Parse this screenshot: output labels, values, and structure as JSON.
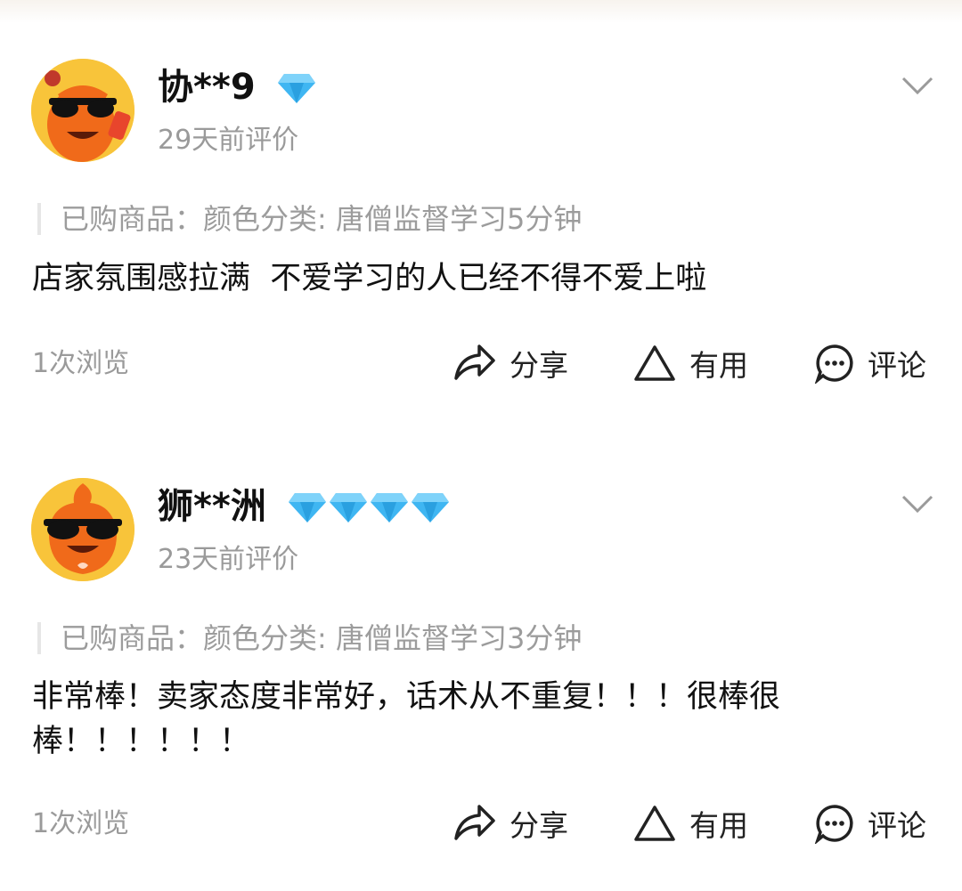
{
  "reviews": [
    {
      "username": "协**9",
      "diamond_level": 1,
      "time": "29天前评价",
      "product": "已购商品：颜色分类: 唐僧监督学习5分钟",
      "content": "店家氛围感拉满  不爱学习的人已经不得不爱上啦",
      "views": "1次浏览",
      "actions": {
        "share": "分享",
        "useful": "有用",
        "comment": "评论"
      }
    },
    {
      "username": "狮**洲",
      "diamond_level": 4,
      "time": "23天前评价",
      "product": "已购商品：颜色分类: 唐僧监督学习3分钟",
      "content": "非常棒！卖家态度非常好，话术从不重复！！！很棒很棒！！！！！！",
      "views": "1次浏览",
      "actions": {
        "share": "分享",
        "useful": "有用",
        "comment": "评论"
      }
    }
  ],
  "icons": {
    "diamond": "diamond-icon",
    "chevron": "chevron-down-icon",
    "share": "share-icon",
    "useful": "triangle-icon",
    "comment": "comment-icon"
  },
  "colors": {
    "diamond": "#3fb6f2",
    "avatar_bg": "#f8c43a",
    "mascot": "#f06a1a"
  }
}
